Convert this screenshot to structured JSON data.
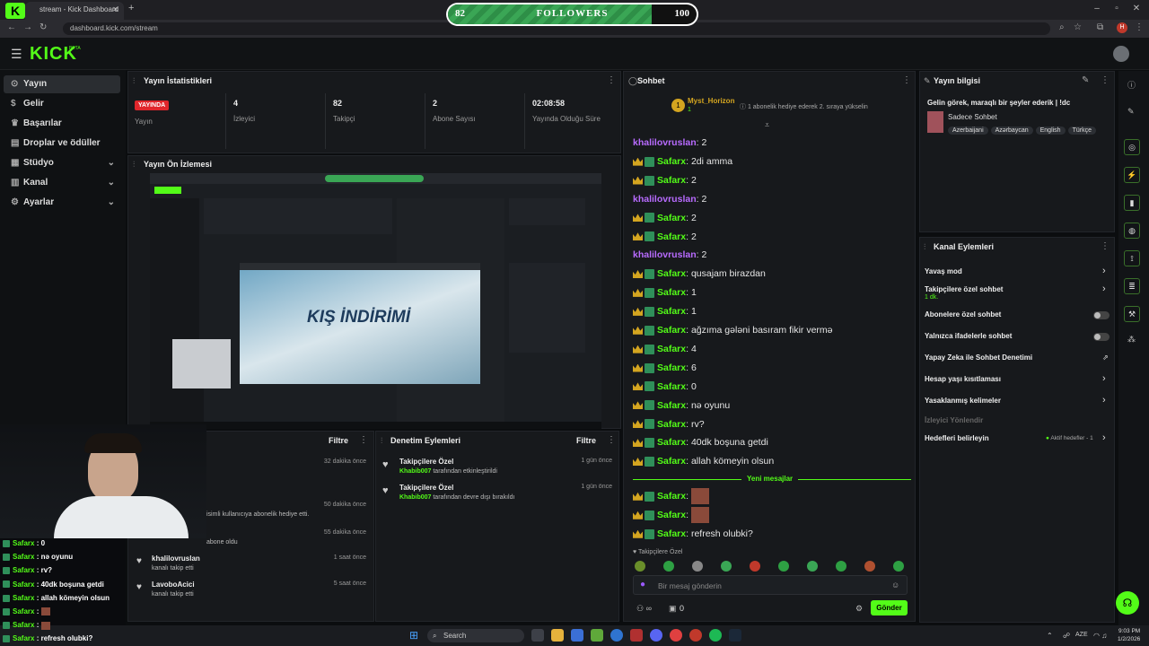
{
  "browser": {
    "tab_title": "Kick Dashboard",
    "tab_prefix": "stream - ",
    "url": "dashboard.kick.com/stream"
  },
  "overlay": {
    "followers_current": "82",
    "followers_label": "FOLLOWERS",
    "followers_goal": "100",
    "follower_progress": 0.82,
    "corner_number": "4"
  },
  "header": {
    "logo": "KICK",
    "beta": "BETA"
  },
  "sidebar": {
    "items": [
      {
        "label": "Yayın",
        "icon": "broadcast-icon",
        "active": true
      },
      {
        "label": "Gelir",
        "icon": "dollar-icon"
      },
      {
        "label": "Başarılar",
        "icon": "trophy-icon"
      },
      {
        "label": "Droplar ve ödüller",
        "icon": "gift-icon"
      },
      {
        "label": "Stüdyo",
        "icon": "video-icon",
        "chevron": true
      },
      {
        "label": "Kanal",
        "icon": "layout-icon",
        "chevron": true
      },
      {
        "label": "Ayarlar",
        "icon": "gear-icon",
        "chevron": true
      }
    ]
  },
  "stats": {
    "title": "Yayın İstatistikleri",
    "live_badge": "YAYINDA",
    "live_label": "Yayın",
    "items": [
      {
        "value": "4",
        "label": "İzleyici"
      },
      {
        "value": "82",
        "label": "Takipçi"
      },
      {
        "value": "2",
        "label": "Abone Sayısı"
      },
      {
        "value": "02:08:58",
        "label": "Yayında Olduğu Süre"
      }
    ]
  },
  "preview": {
    "title": "Yayın Ön İzlemesi",
    "banner": "KIŞ İNDİRİMİ"
  },
  "activity": {
    "filter": "Filtre",
    "rows": [
      {
        "time": "32 dakika önce"
      },
      {
        "time": "50 dakika önce",
        "text": "isimli kullanıcıya abonelik hediye etti."
      },
      {
        "time": "55 dakika önce",
        "text": "abone oldu"
      },
      {
        "name": "khalilovruslan",
        "text": "kanalı takip etti",
        "time": "1 saat önce"
      },
      {
        "name": "LavoboAcici",
        "text": "kanalı takip etti",
        "time": "5 saat önce"
      }
    ]
  },
  "moderation": {
    "title": "Denetim Eylemleri",
    "filter": "Filtre",
    "rows": [
      {
        "title": "Takipçilere Özel",
        "user": "Khabib007",
        "text": "tarafından etkinleştirildi",
        "time": "1 gün önce"
      },
      {
        "title": "Takipçilere Özel",
        "user": "Khabib007",
        "text": "tarafından devre dışı bırakıldı",
        "time": "1 gün önce"
      }
    ]
  },
  "chat": {
    "title": "Sohbet",
    "pinned_user": "Myst_Horizon",
    "pinned_count": "1",
    "pinned_text": "1 abonelik hediye ederek 2. sıraya yükselin",
    "messages": [
      {
        "u": "khalilovruslan",
        "t": "2",
        "k": "kha"
      },
      {
        "u": "Safarx",
        "t": "2di amma",
        "k": "saf"
      },
      {
        "u": "Safarx",
        "t": "2",
        "k": "saf"
      },
      {
        "u": "khalilovruslan",
        "t": "2",
        "k": "kha"
      },
      {
        "u": "Safarx",
        "t": "2",
        "k": "saf"
      },
      {
        "u": "Safarx",
        "t": "2",
        "k": "saf"
      },
      {
        "u": "khalilovruslan",
        "t": "2",
        "k": "kha"
      },
      {
        "u": "Safarx",
        "t": "qusajam birazdan",
        "k": "saf"
      },
      {
        "u": "Safarx",
        "t": "1",
        "k": "saf"
      },
      {
        "u": "Safarx",
        "t": "1",
        "k": "saf"
      },
      {
        "u": "Safarx",
        "t": "ağzıma gələni basıram fikir vermə",
        "k": "saf"
      },
      {
        "u": "Safarx",
        "t": "4",
        "k": "saf"
      },
      {
        "u": "Safarx",
        "t": "6",
        "k": "saf"
      },
      {
        "u": "Safarx",
        "t": "0",
        "k": "saf"
      },
      {
        "u": "Safarx",
        "t": "nə oyunu",
        "k": "saf"
      },
      {
        "u": "Safarx",
        "t": "rv?",
        "k": "saf"
      },
      {
        "u": "Safarx",
        "t": "40dk boşuna getdi",
        "k": "saf"
      },
      {
        "u": "Safarx",
        "t": "allah kömeyin olsun",
        "k": "saf"
      }
    ],
    "new_messages": "Yeni mesajlar",
    "after": [
      {
        "u": "Safarx",
        "t": "",
        "img": true
      },
      {
        "u": "Safarx",
        "t": "",
        "img": true
      },
      {
        "u": "Safarx",
        "t": "refresh olubki?"
      }
    ],
    "followers_only": "Takipçilere Özel",
    "input_placeholder": "Bir mesaj gönderin",
    "send": "Gönder",
    "count": "0"
  },
  "stream_info": {
    "title": "Yayın bilgisi",
    "stream_title": "Gelin görek, maraqlı bir şeyler ederik | !dc",
    "category": "Sadece Sohbet",
    "tags": [
      "Azerbaijani",
      "Azərbaycan",
      "English",
      "Türkçe"
    ]
  },
  "channel_actions": {
    "title": "Kanal Eylemleri",
    "rows": [
      {
        "label": "Yavaş mod",
        "ctrl": "chev"
      },
      {
        "label": "Takipçilere özel sohbet",
        "sub": "1 dk.",
        "ctrl": "chev"
      },
      {
        "label": "Abonelere özel sohbet",
        "ctrl": "toggle"
      },
      {
        "label": "Yalnızca ifadelerle sohbet",
        "ctrl": "toggle"
      },
      {
        "label": "Yapay Zeka ile Sohbet Denetimi",
        "ctrl": "ext"
      },
      {
        "label": "Hesap yaşı kısıtlaması",
        "ctrl": "chev"
      },
      {
        "label": "Yasaklanmış kelimeler",
        "ctrl": "chev"
      },
      {
        "label": "İzleyici Yönlendir",
        "ctrl": "none",
        "dim": true
      },
      {
        "label": "Hedefleri belirleyin",
        "ctrl": "chev",
        "status": "Aktif hedefler - 1"
      }
    ]
  },
  "overlay_chat": [
    {
      "u": "Safarx",
      "t": "0"
    },
    {
      "u": "Safarx",
      "t": "nə oyunu"
    },
    {
      "u": "Safarx",
      "t": "rv?"
    },
    {
      "u": "Safarx",
      "t": "40dk boşuna getdi"
    },
    {
      "u": "Safarx",
      "t": "allah kömeyin olsun"
    },
    {
      "u": "Safarx",
      "t": ""
    },
    {
      "u": "Safarx",
      "t": ""
    },
    {
      "u": "Safarx",
      "t": "refresh olubki?"
    }
  ],
  "taskbar": {
    "search": "Search",
    "lang": "AZE",
    "time": "9:03 PM",
    "date": "1/2/2026"
  }
}
